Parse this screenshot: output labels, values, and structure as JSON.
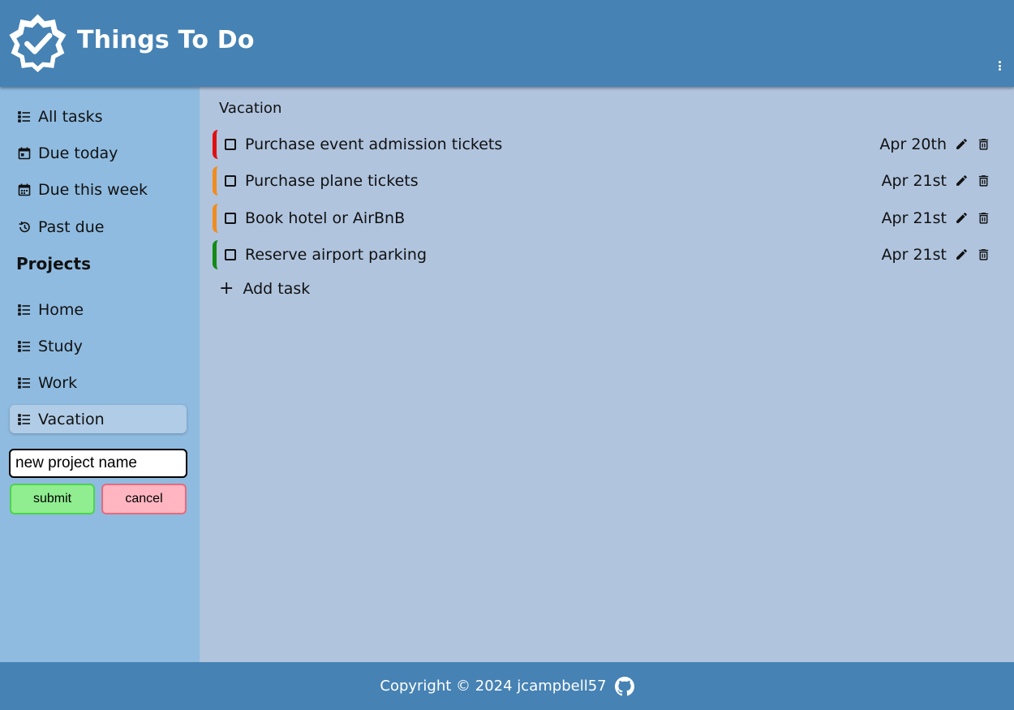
{
  "header": {
    "title": "Things To Do",
    "logo_icon": "verified-badge-icon",
    "menu_icon": "more-vertical-icon"
  },
  "sidebar": {
    "items": [
      {
        "label": "All tasks",
        "icon": "list-icon"
      },
      {
        "label": "Due today",
        "icon": "calendar-today-icon"
      },
      {
        "label": "Due this week",
        "icon": "calendar-week-icon"
      },
      {
        "label": "Past due",
        "icon": "history-icon"
      }
    ],
    "projects_heading": "Projects",
    "projects": [
      {
        "label": "Home",
        "icon": "list-icon"
      },
      {
        "label": "Study",
        "icon": "list-icon"
      },
      {
        "label": "Work",
        "icon": "list-icon"
      },
      {
        "label": "Vacation",
        "icon": "list-icon",
        "active": true
      }
    ],
    "new_project": {
      "value": "new project name",
      "placeholder": ""
    },
    "submit_label": "submit",
    "cancel_label": "cancel"
  },
  "main": {
    "project_title": "Vacation",
    "tasks": [
      {
        "name": "Purchase event admission tickets",
        "due": "Apr 20th",
        "priority_color": "#e01010"
      },
      {
        "name": "Purchase plane tickets",
        "due": "Apr 21st",
        "priority_color": "#f28c1c"
      },
      {
        "name": "Book hotel or AirBnB",
        "due": "Apr 21st",
        "priority_color": "#f28c1c"
      },
      {
        "name": "Reserve airport parking",
        "due": "Apr 21st",
        "priority_color": "#138a13"
      }
    ],
    "add_task_label": "Add task"
  },
  "footer": {
    "text": "Copyright © 2024 jcampbell57",
    "icon": "github-icon"
  },
  "colors": {
    "header": "#4682b4",
    "sidebar": "#8fbbe0",
    "main": "#b0c4de",
    "submit": "#90ee90",
    "cancel": "#ffb6c1"
  }
}
